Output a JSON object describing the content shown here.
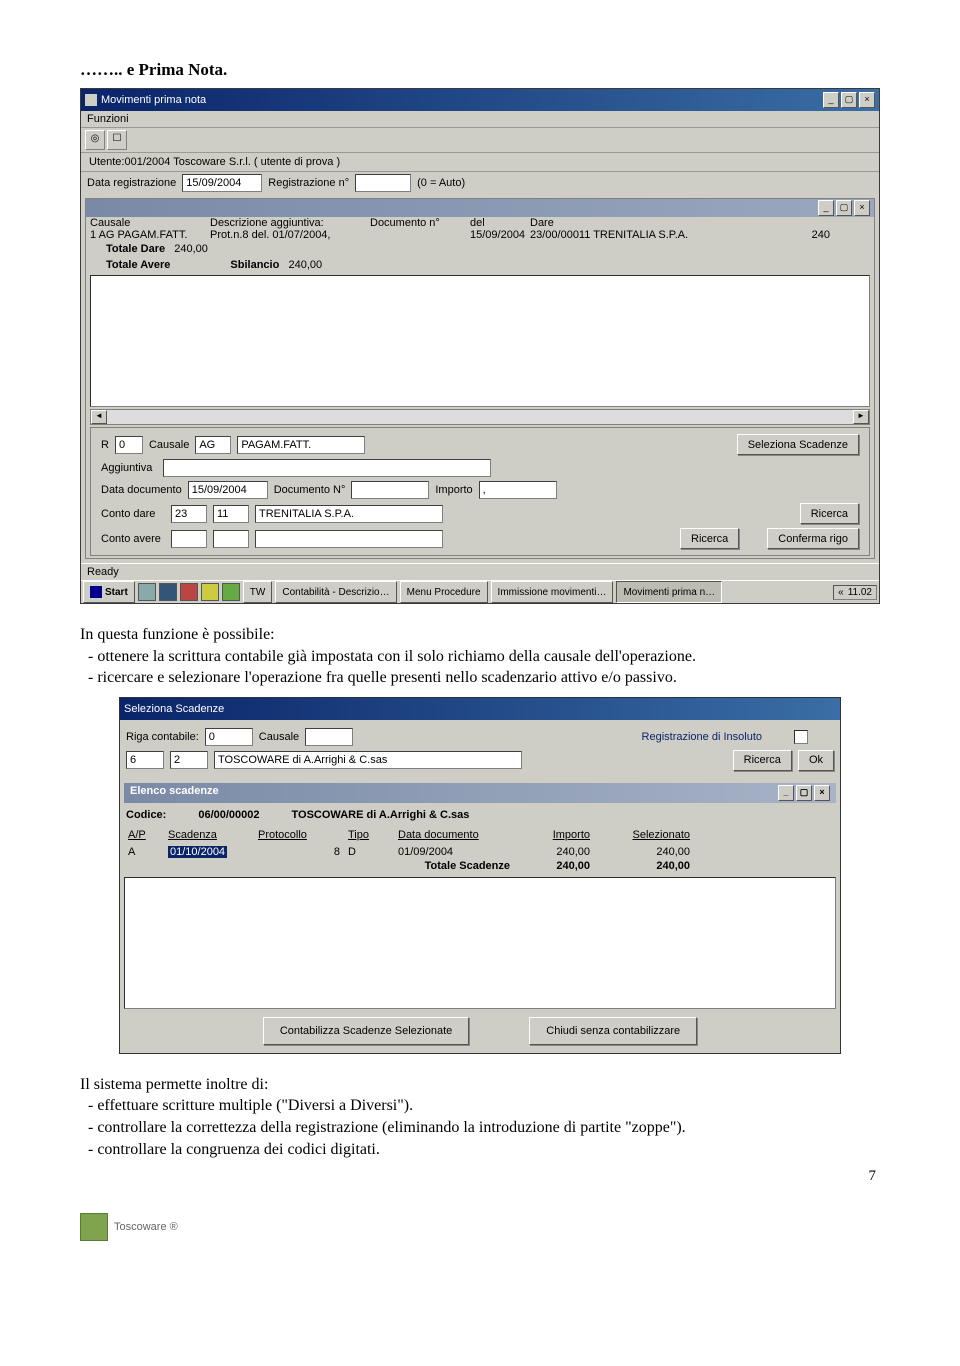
{
  "doc": {
    "heading": "…….. e Prima Nota.",
    "para1_lead": "In questa funzione è possibile:",
    "para1_b1": "- ottenere la scrittura contabile già impostata con il solo richiamo della causale dell'operazione.",
    "para1_b2": "- ricercare e selezionare l'operazione fra quelle presenti nello scadenzario attivo e/o passivo.",
    "para2_lead": "Il sistema permette inoltre di:",
    "para2_b1": "- effettuare scritture multiple (\"Diversi a Diversi\").",
    "para2_b2": "- controllare la correttezza della registrazione (eliminando la introduzione di partite \"zoppe\").",
    "para2_b3": "- controllare la congruenza dei codici digitati.",
    "page_num": "7",
    "footer_brand": "Toscoware ®"
  },
  "win1": {
    "title": "Movimenti prima nota",
    "menu": "Funzioni",
    "utente": "Utente:001/2004 Toscoware S.r.l. ( utente di prova )",
    "data_reg_lbl": "Data registrazione",
    "data_reg_val": "15/09/2004",
    "reg_n_lbl": "Registrazione n°",
    "reg_n_val": "",
    "autohint": "(0 = Auto)",
    "grid": {
      "h_causale": "Causale",
      "h_descr": "Descrizione aggiuntiva:",
      "h_docn": "Documento n°",
      "h_del": "del",
      "h_dare": "Dare",
      "r1_c": "1  AG  PAGAM.FATT.",
      "r1_d": "Prot.n.8 del. 01/07/2004,",
      "r1_doc": "",
      "r1_del": "15/09/2004",
      "r1_dare": "23/00/00011 TRENITALIA S.P.A.",
      "r1_imp": "240",
      "tot_dare_lbl": "Totale Dare",
      "tot_dare": "240,00",
      "tot_avere_lbl": "Totale Avere",
      "sbil_lbl": "Sbilancio",
      "sbil": "240,00"
    },
    "panel": {
      "r_lbl": "R",
      "r_val": "0",
      "causale_lbl": "Causale",
      "causale_c1": "AG",
      "causale_c2": "PAGAM.FATT.",
      "seleziona": "Seleziona Scadenze",
      "aggiuntiva_lbl": "Aggiuntiva",
      "datadoc_lbl": "Data documento",
      "datadoc_val": "15/09/2004",
      "docn_lbl": "Documento N°",
      "importo_lbl": "Importo",
      "importo_dot": ",",
      "cdare_lbl": "Conto dare",
      "cdare_a": "23",
      "cdare_b": "11",
      "cdare_c": "TRENITALIA S.P.A.",
      "cavere_lbl": "Conto avere",
      "ricerca": "Ricerca",
      "conferma_rigo": "Conferma rigo"
    },
    "ready": "Ready",
    "taskbar": {
      "start": "Start",
      "t_tw": "TW",
      "t_cont": "Contabilità - Descrizio…",
      "t_menu": "Menu Procedure",
      "t_imm": "Immissione movimenti…",
      "t_mov": "Movimenti prima n…",
      "clock": "11.02"
    }
  },
  "win2": {
    "title": "Seleziona Scadenze",
    "riga_lbl": "Riga contabile:",
    "riga_val": "0",
    "causale_lbl": "Causale",
    "reg_insoluto": "Registrazione di Insoluto",
    "code1": "6",
    "code2": "2",
    "code_name": "TOSCOWARE di A.Arrighi & C.sas",
    "ricerca": "Ricerca",
    "ok": "Ok",
    "elenco_title": "Elenco scadenze",
    "codice_lbl": "Codice:",
    "codice_val": "06/00/00002",
    "codice_name": "TOSCOWARE di A.Arrighi & C.sas",
    "hdr_ap": "A/P",
    "hdr_scad": "Scadenza",
    "hdr_prot": "Protocollo",
    "hdr_tipo": "Tipo",
    "hdr_ddoc": "Data documento",
    "hdr_imp": "Importo",
    "hdr_sel": "Selezionato",
    "row_ap": "A",
    "row_scad": "01/10/2004",
    "row_prot": "8",
    "row_tipo": "D",
    "row_ddoc": "01/09/2004",
    "row_imp": "240,00",
    "row_sel": "240,00",
    "tot_lbl": "Totale Scadenze",
    "tot_imp": "240,00",
    "tot_sel": "240,00",
    "btn_contab": "Contabilizza Scadenze Selezionate",
    "btn_chiudi": "Chiudi senza contabilizzare"
  }
}
